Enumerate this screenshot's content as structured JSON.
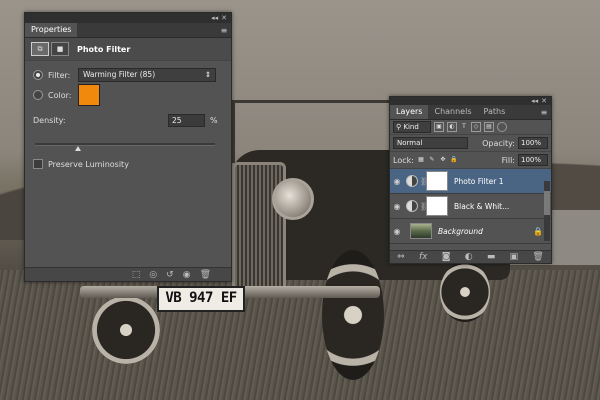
{
  "photo": {
    "plate_text": "VB 947 EF"
  },
  "properties": {
    "tab": "Properties",
    "title": "Photo Filter",
    "filter": {
      "label": "Filter:",
      "value": "Warming Filter (85)"
    },
    "color": {
      "label": "Color:",
      "swatch": "#f18a0c"
    },
    "density": {
      "label": "Density:",
      "value": "25",
      "unit": "%",
      "level_percent": 25
    },
    "preserve": {
      "label": "Preserve Luminosity",
      "checked": false
    },
    "footer_icons": [
      "clip-to-layer-icon",
      "view-previous-icon",
      "reset-icon",
      "visibility-icon",
      "delete-icon"
    ]
  },
  "layers": {
    "tabs": [
      "Layers",
      "Channels",
      "Paths"
    ],
    "filter_kind": "Kind",
    "blend_mode": "Normal",
    "opacity": {
      "label": "Opacity:",
      "value": "100%"
    },
    "lock_label": "Lock:",
    "fill": {
      "label": "Fill:",
      "value": "100%"
    },
    "items": [
      {
        "name": "Photo Filter 1",
        "selected": true
      },
      {
        "name": "Black & Whit...",
        "selected": false
      },
      {
        "name": "Background",
        "selected": false
      }
    ],
    "footer_icons": [
      "link-icon",
      "fx-icon",
      "mask-icon",
      "adjustment-icon",
      "folder-icon",
      "new-layer-icon",
      "delete-icon"
    ],
    "footer_glyphs": [
      "⇔",
      "fx",
      "◙",
      "◐",
      "▬",
      "▣",
      "🗑"
    ]
  }
}
